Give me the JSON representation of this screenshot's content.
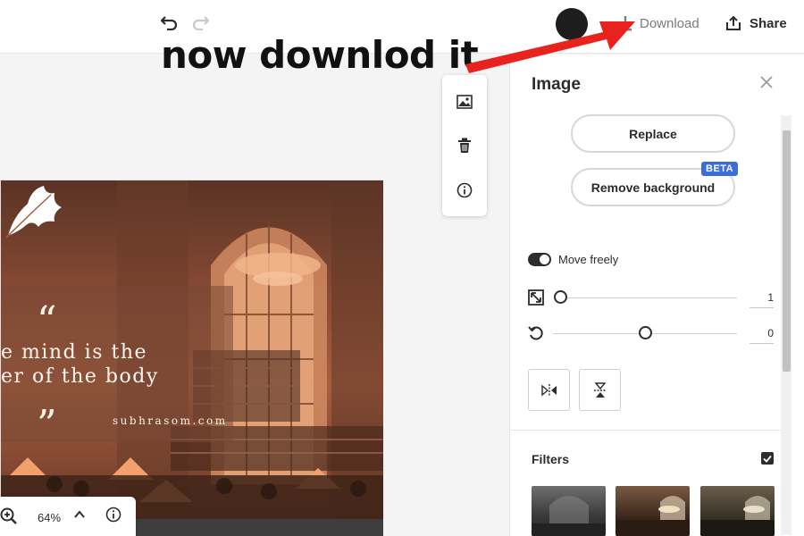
{
  "toolbar": {
    "download_label": "Download",
    "share_label": "Share",
    "undo_icon": "undo-icon",
    "redo_icon": "redo-icon"
  },
  "annotation": {
    "text": "now downlod it",
    "arrow_color": "#e8221c"
  },
  "canvas": {
    "watermark": "om.com",
    "design": {
      "quote_line_1": "e mind is the",
      "quote_line_2": "er of the body",
      "signature": "subhrasom.com",
      "open_quote": "“",
      "close_quote": "”"
    },
    "floating_toolbar": [
      "image-icon",
      "trash-icon",
      "info-icon"
    ]
  },
  "zoom": {
    "value": "64%"
  },
  "panel": {
    "title": "Image",
    "replace_label": "Replace",
    "remove_background_label": "Remove background",
    "beta_badge": "BETA",
    "move_freely_label": "Move freely",
    "move_freely_on": true,
    "scale_value": "1",
    "rotate_value": "0",
    "filters_label": "Filters",
    "filters_checked": true,
    "accent_color": "#3d6dd8"
  }
}
